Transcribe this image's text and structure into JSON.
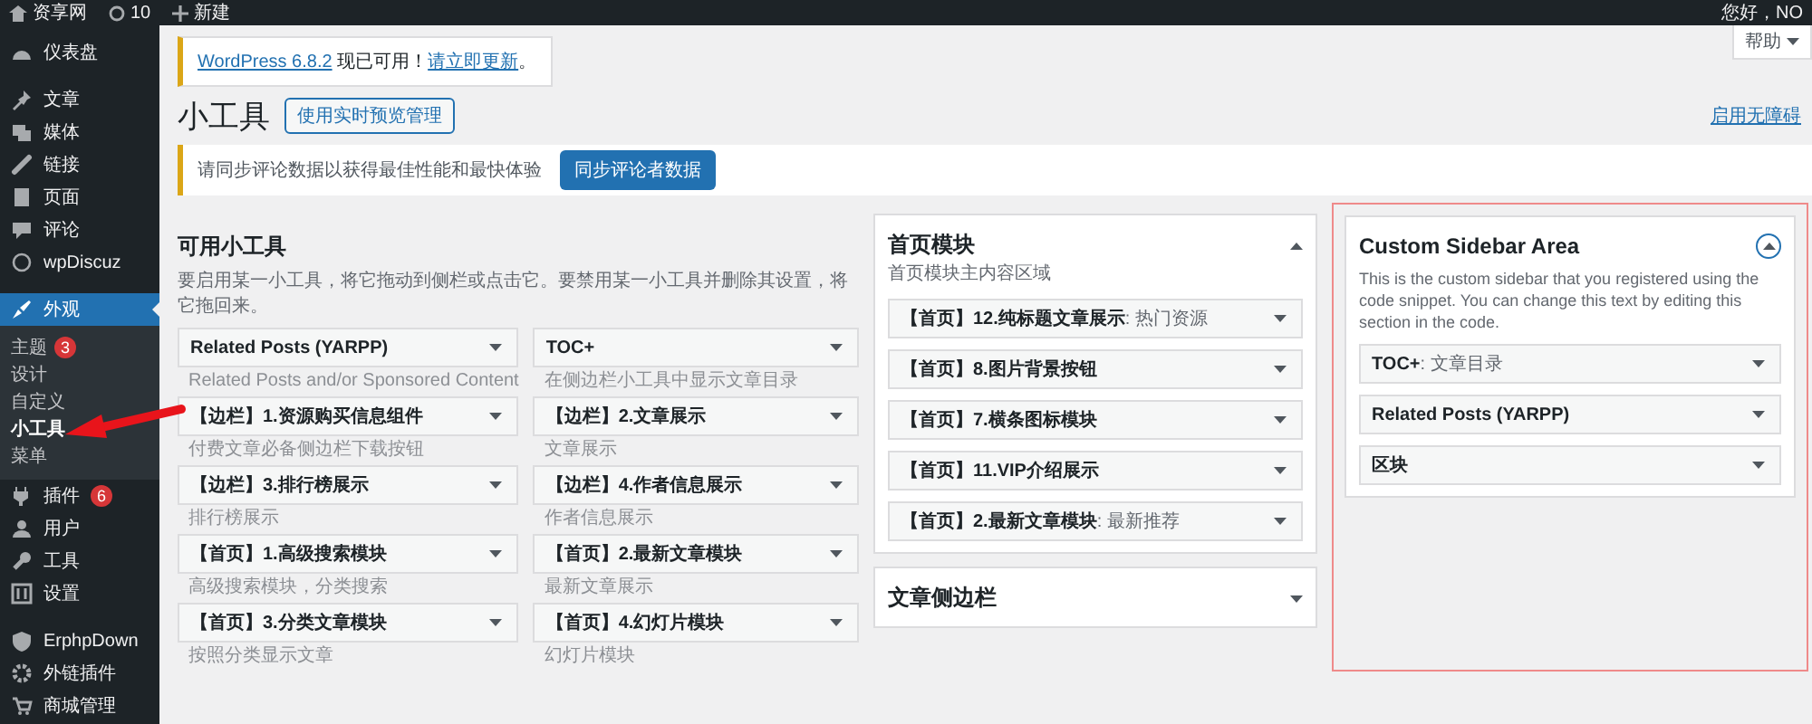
{
  "admin_bar": {
    "site_name": "资享网",
    "updates": "10",
    "new_label": "新建",
    "greeting": "您好，NO"
  },
  "sidebar": {
    "groups": [
      [
        {
          "label": "仪表盘",
          "selected": false
        }
      ],
      [
        {
          "label": "文章",
          "selected": false
        },
        {
          "label": "媒体",
          "selected": false
        },
        {
          "label": "链接",
          "selected": false
        },
        {
          "label": "页面",
          "selected": false
        },
        {
          "label": "评论",
          "selected": false
        },
        {
          "label": "wpDiscuz",
          "selected": false
        }
      ],
      [
        {
          "label": "外观",
          "selected": true,
          "children": [
            {
              "label": "主题",
              "badge": "3",
              "selected": false
            },
            {
              "label": "设计",
              "selected": false
            },
            {
              "label": "自定义",
              "selected": false
            },
            {
              "label": "小工具",
              "selected": true
            },
            {
              "label": "菜单",
              "selected": false
            }
          ]
        },
        {
          "label": "插件",
          "badge": "6",
          "selected": false
        },
        {
          "label": "用户",
          "selected": false
        },
        {
          "label": "工具",
          "selected": false
        },
        {
          "label": "设置",
          "selected": false
        }
      ],
      [
        {
          "label": "ErphpDown",
          "selected": false
        },
        {
          "label": "外链插件",
          "selected": false
        },
        {
          "label": "商城管理",
          "selected": false
        }
      ]
    ]
  },
  "help_tab": {
    "label": "帮助"
  },
  "update_notice": {
    "parts": [
      {
        "text": "WordPress 6.8.2",
        "link": true
      },
      {
        "text": " 现已可用！",
        "link": false
      },
      {
        "text": "请立即更新",
        "link": true
      },
      {
        "text": "。",
        "link": false
      }
    ]
  },
  "page_title": "小工具",
  "preview_button": "使用实时预览管理",
  "accessibility_link": "启用无障碍",
  "sync_notice": {
    "text": "请同步评论数据以获得最佳性能和最快体验",
    "button": "同步评论者数据"
  },
  "available_widgets": {
    "title": "可用小工具",
    "description": "要启用某一小工具，将它拖动到侧栏或点击它。要禁用某一小工具并删除其设置，将它拖回来。",
    "widgets": [
      {
        "title": "Related Posts (YARPP)",
        "description": "Related Posts and/or Sponsored Content"
      },
      {
        "title": "TOC+",
        "description": "在侧边栏小工具中显示文章目录"
      },
      {
        "title": "【边栏】1.资源购买信息组件",
        "description": "付费文章必备侧边栏下载按钮"
      },
      {
        "title": "【边栏】2.文章展示",
        "description": "文章展示"
      },
      {
        "title": "【边栏】3.排行榜展示",
        "description": "排行榜展示"
      },
      {
        "title": "【边栏】4.作者信息展示",
        "description": "作者信息展示"
      },
      {
        "title": "【首页】1.高级搜索模块",
        "description": "高级搜索模块，分类搜索"
      },
      {
        "title": "【首页】2.最新文章模块",
        "description": "最新文章展示"
      },
      {
        "title": "【首页】3.分类文章模块",
        "description": "按照分类显示文章"
      },
      {
        "title": "【首页】4.幻灯片模块",
        "description": "幻灯片模块"
      }
    ]
  },
  "sidebar_areas": [
    {
      "title": "首页模块",
      "description": "首页模块主内容区域",
      "expanded": true,
      "widgets": [
        {
          "title": "【首页】12.纯标题文章展示",
          "subtitle": ": 热门资源"
        },
        {
          "title": "【首页】8.图片背景按钮"
        },
        {
          "title": "【首页】7.横条图标模块"
        },
        {
          "title": "【首页】11.VIP介绍展示"
        },
        {
          "title": "【首页】2.最新文章模块",
          "subtitle": ": 最新推荐"
        }
      ]
    },
    {
      "title": "文章侧边栏",
      "expanded": false
    }
  ],
  "custom_area": {
    "title": "Custom Sidebar Area",
    "description": "This is the custom sidebar that you registered using the code snippet. You can change this text by editing this section in the code.",
    "expanded": true,
    "widgets": [
      {
        "title": "TOC+",
        "subtitle": ": 文章目录"
      },
      {
        "title": "Related Posts (YARPP)"
      },
      {
        "title": "区块"
      }
    ]
  }
}
